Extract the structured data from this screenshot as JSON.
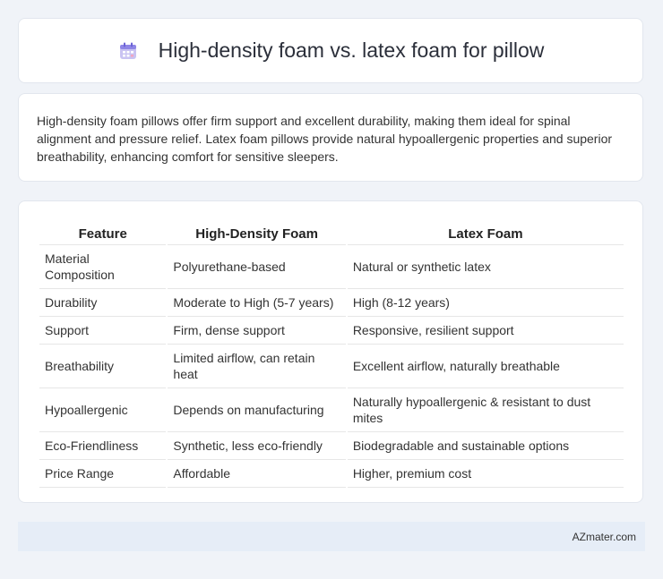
{
  "header": {
    "title": "High-density foam vs. latex foam for pillow",
    "icon": "calendar-icon"
  },
  "summary": {
    "text": "High-density foam pillows offer firm support and excellent durability, making them ideal for spinal alignment and pressure relief. Latex foam pillows provide natural hypoallergenic properties and superior breathability, enhancing comfort for sensitive sleepers."
  },
  "table": {
    "headers": [
      "Feature",
      "High-Density Foam",
      "Latex Foam"
    ],
    "rows": [
      [
        "Material Composition",
        "Polyurethane-based",
        "Natural or synthetic latex"
      ],
      [
        "Durability",
        "Moderate to High (5-7 years)",
        "High (8-12 years)"
      ],
      [
        "Support",
        "Firm, dense support",
        "Responsive, resilient support"
      ],
      [
        "Breathability",
        "Limited airflow, can retain heat",
        "Excellent airflow, naturally breathable"
      ],
      [
        "Hypoallergenic",
        "Depends on manufacturing",
        "Naturally hypoallergenic & resistant to dust mites"
      ],
      [
        "Eco-Friendliness",
        "Synthetic, less eco-friendly",
        "Biodegradable and sustainable options"
      ],
      [
        "Price Range",
        "Affordable",
        "Higher, premium cost"
      ]
    ]
  },
  "footer": {
    "text": "AZmater.com"
  }
}
